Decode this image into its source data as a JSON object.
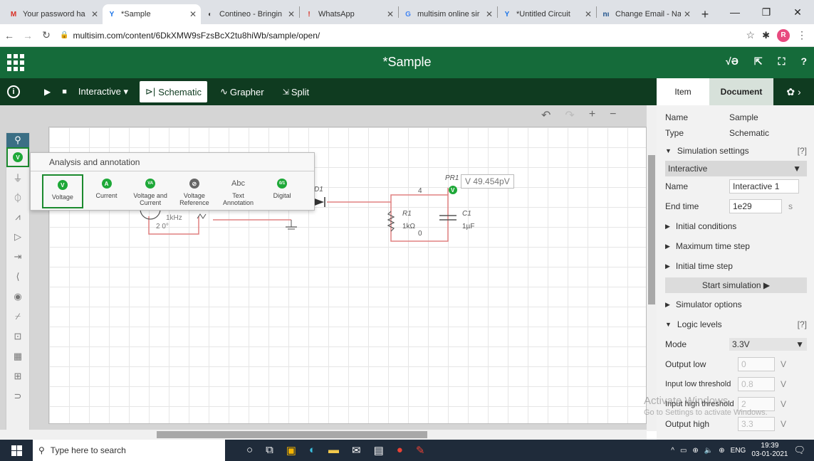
{
  "browser": {
    "tabs": [
      {
        "label": "Your password ha",
        "fav": "M",
        "favcolor": "#d93025",
        "active": false
      },
      {
        "label": "*Sample",
        "fav": "Y",
        "favcolor": "#1a73e8",
        "active": true
      },
      {
        "label": "Contineo - Bringin",
        "fav": "◐",
        "favcolor": "#444",
        "active": false
      },
      {
        "label": "WhatsApp",
        "fav": "!",
        "favcolor": "#d93025",
        "active": false
      },
      {
        "label": "multisim online sir",
        "fav": "G",
        "favcolor": "#4285f4",
        "active": false
      },
      {
        "label": "*Untitled Circuit",
        "fav": "Y",
        "favcolor": "#1a73e8",
        "active": false
      },
      {
        "label": "Change Email - Na",
        "fav": "nı",
        "favcolor": "#1a4f8a",
        "active": false
      }
    ],
    "url": "multisim.com/content/6DkXMW9sFzsBcX2tu8hiWb/sample/open/",
    "profile_initial": "R"
  },
  "app": {
    "title": "*Sample",
    "toolbar": {
      "mode": "Interactive ▾",
      "schematic": "Schematic",
      "grapher": "Grapher",
      "split": "Split"
    }
  },
  "panel": {
    "tab_item": "Item",
    "tab_document": "Document",
    "name_label": "Name",
    "name_value": "Sample",
    "type_label": "Type",
    "type_value": "Schematic",
    "sim_settings": "Simulation settings",
    "help": "[?]",
    "sim_mode": "Interactive",
    "sim_name_label": "Name",
    "sim_name_value": "Interactive 1",
    "end_time_label": "End time",
    "end_time_value": "1e29",
    "end_time_unit": "s",
    "initial_conditions": "Initial conditions",
    "max_time_step": "Maximum time step",
    "initial_time_step": "Initial time step",
    "start_sim": "Start simulation ▶",
    "simulator_options": "Simulator options",
    "logic_levels": "Logic levels",
    "mode_label": "Mode",
    "mode_value": "3.3V",
    "output_low_label": "Output low",
    "output_low_value": "0",
    "in_low_thr_label": "Input low threshold",
    "in_low_thr_value": "0.8",
    "in_high_thr_label": "Input high threshold",
    "in_high_thr_value": "2",
    "output_high_label": "Output high",
    "output_high_value": "3.3",
    "volt_unit": "V"
  },
  "popup": {
    "title": "Analysis and annotation",
    "items": [
      {
        "label": "Voltage",
        "glyph": "V"
      },
      {
        "label": "Current",
        "glyph": "A"
      },
      {
        "label": "Voltage and Current",
        "glyph": "VA"
      },
      {
        "label": "Voltage Reference",
        "glyph": "⊘"
      },
      {
        "label": "Text Annotation",
        "glyph": "Abc"
      },
      {
        "label": "Digital",
        "glyph": "0/1"
      }
    ]
  },
  "schematic": {
    "probe_label": "PR1",
    "probe_value": "V 49.454pV",
    "node4": "4",
    "node0": "0",
    "r1": "R1",
    "r1_val": "1kΩ",
    "c1": "C1",
    "c1_val": "1µF",
    "d1": "D1",
    "src_freq": "1kHz",
    "src_phase": "2 0°"
  },
  "activate": {
    "line1": "Activate Windows",
    "line2": "Go to Settings to activate Windows."
  },
  "taskbar": {
    "search_placeholder": "Type here to search",
    "lang": "ENG",
    "time": "19:39",
    "date": "03-01-2021"
  }
}
